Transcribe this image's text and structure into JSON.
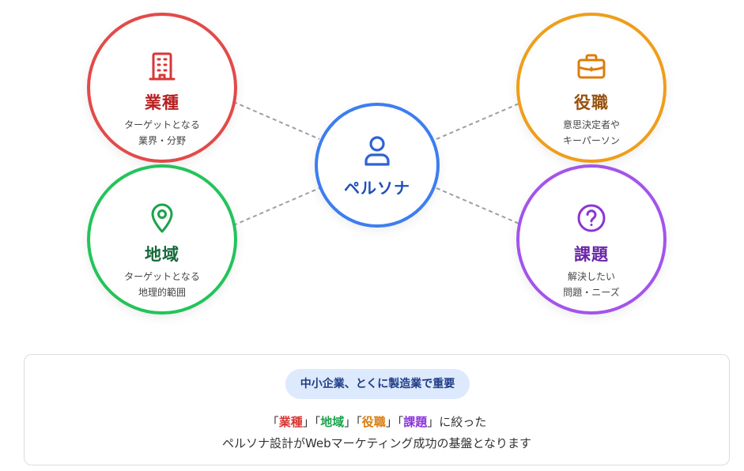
{
  "center": {
    "title": "ペルソナ",
    "icon": "person-icon",
    "color": "#3d7df0"
  },
  "nodes": {
    "industry": {
      "title": "業種",
      "desc": [
        "ターゲットとなる",
        "業界・分野"
      ],
      "icon": "building-icon",
      "color": "#e24a49"
    },
    "position": {
      "title": "役職",
      "desc": [
        "意思決定者や",
        "キーパーソン"
      ],
      "icon": "briefcase-icon",
      "color": "#ef9e1a"
    },
    "region": {
      "title": "地域",
      "desc": [
        "ターゲットとなる",
        "地理的範囲"
      ],
      "icon": "map-pin-icon",
      "color": "#23c45a"
    },
    "issue": {
      "title": "課題",
      "desc": [
        "解決したい",
        "問題・ニーズ"
      ],
      "icon": "question-circle-icon",
      "color": "#a354ec"
    }
  },
  "info": {
    "pill": "中小企業、とくに製造業で重要",
    "line1": {
      "open": "「",
      "k1": "業種",
      "s1": "」「",
      "k2": "地域",
      "s2": "」「",
      "k3": "役職",
      "s3": "」「",
      "k4": "課題",
      "close": "」に絞った"
    },
    "line2": "ペルソナ設計がWebマーケティング成功の基盤となります"
  }
}
